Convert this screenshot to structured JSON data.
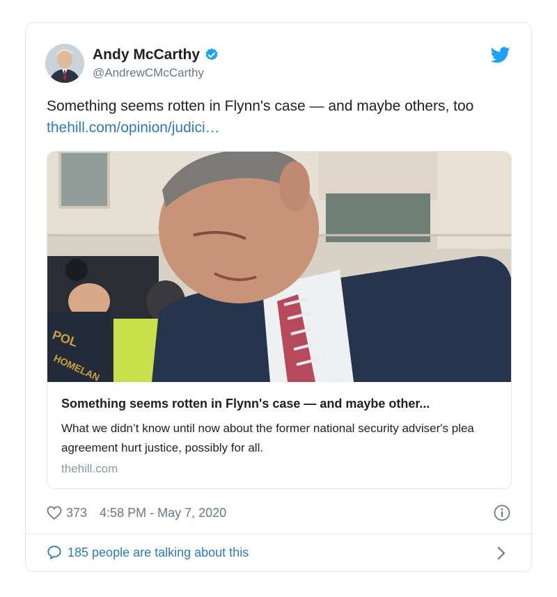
{
  "author": {
    "name": "Andy McCarthy",
    "handle": "@AndrewCMcCarthy"
  },
  "tweet": {
    "text": "Something seems rotten in Flynn's case — and maybe others, too ",
    "link_text": "thehill.com/opinion/judici…"
  },
  "link_card": {
    "title": "Something seems rotten in Flynn's case — and maybe other...",
    "description": "What we didn’t know until now about the former national security adviser's plea agreement hurt justice, possibly for all.",
    "domain": "thehill.com"
  },
  "meta": {
    "likes": "373",
    "timestamp": "4:58 PM - May 7, 2020"
  },
  "footer": {
    "talking": "185 people are talking about this"
  },
  "icons": {
    "verified": "verified-badge-icon",
    "brand": "twitter-bird-icon",
    "like": "heart-icon",
    "info": "info-icon",
    "reply": "speech-bubble-icon",
    "chevron": "chevron-right-icon"
  },
  "colors": {
    "link": "#2b7bb9",
    "verified": "#1da1f2",
    "muted": "#697882",
    "border": "#e1e8ed"
  }
}
